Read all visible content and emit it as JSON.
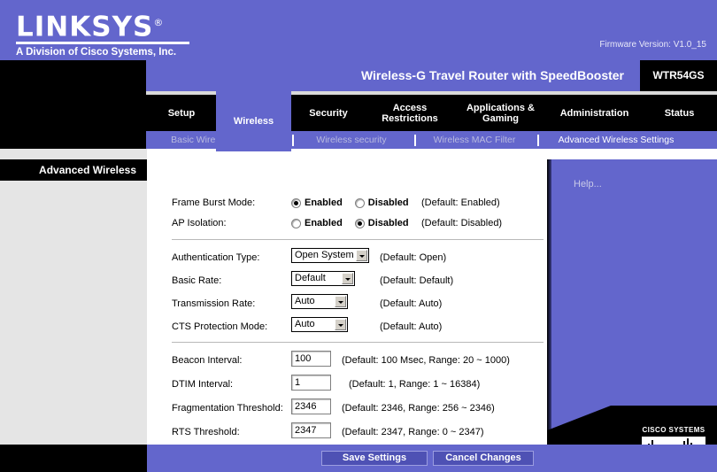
{
  "header": {
    "brand": "LINKSYS",
    "brand_reg": "®",
    "tagline": "A Division of Cisco Systems, Inc.",
    "firmware": "Firmware Version: V1.0_15"
  },
  "product": {
    "name": "Wireless-G Travel Router with SpeedBooster",
    "model": "WTR54GS"
  },
  "tabs": [
    {
      "label": "Setup",
      "active": false
    },
    {
      "label": "Wireless",
      "active": true
    },
    {
      "label": "Security",
      "active": false
    },
    {
      "label": "Access Restrictions",
      "active": false
    },
    {
      "label": "Applications & Gaming",
      "active": false
    },
    {
      "label": "Administration",
      "active": false
    },
    {
      "label": "Status",
      "active": false
    }
  ],
  "subnav": [
    {
      "label": "Basic Wireless Settings",
      "active": false
    },
    {
      "label": "Wireless security",
      "active": false
    },
    {
      "label": "Wireless MAC Filter",
      "active": false
    },
    {
      "label": "Advanced Wireless Settings",
      "active": true
    }
  ],
  "section": {
    "title": "Advanced Wireless"
  },
  "help": {
    "label": "Help..."
  },
  "cisco": {
    "name": "CISCO SYSTEMS",
    "reg": "®"
  },
  "form": {
    "frame_burst": {
      "label": "Frame Burst Mode:",
      "enabled_label": "Enabled",
      "disabled_label": "Disabled",
      "selected": "Enabled",
      "hint": "(Default: Enabled)"
    },
    "ap_isolation": {
      "label": "AP Isolation:",
      "enabled_label": "Enabled",
      "disabled_label": "Disabled",
      "selected": "Disabled",
      "hint": "(Default: Disabled)"
    },
    "auth_type": {
      "label": "Authentication Type:",
      "value": "Open System",
      "hint": "(Default: Open)"
    },
    "basic_rate": {
      "label": "Basic Rate:",
      "value": "Default",
      "hint": "(Default: Default)"
    },
    "transmission_rate": {
      "label": "Transmission Rate:",
      "value": "Auto",
      "hint": "(Default: Auto)"
    },
    "cts_protection": {
      "label": "CTS Protection Mode:",
      "value": "Auto",
      "hint": "(Default: Auto)"
    },
    "beacon_interval": {
      "label": "Beacon Interval:",
      "value": "100",
      "hint": "(Default: 100 Msec, Range: 20 ~ 1000)"
    },
    "dtim_interval": {
      "label": "DTIM Interval:",
      "value": "1",
      "hint": "(Default: 1, Range: 1 ~ 16384)"
    },
    "fragmentation_threshold": {
      "label": "Fragmentation Threshold:",
      "value": "2346",
      "hint": "(Default: 2346, Range: 256 ~ 2346)"
    },
    "rts_threshold": {
      "label": "RTS Threshold:",
      "value": "2347",
      "hint": "(Default: 2347, Range: 0 ~ 2347)"
    }
  },
  "footer": {
    "save_label": "Save Settings",
    "cancel_label": "Cancel Changes"
  },
  "colors": {
    "purple": "#6366cc",
    "black": "#000000",
    "gray": "#e5e5e5"
  }
}
